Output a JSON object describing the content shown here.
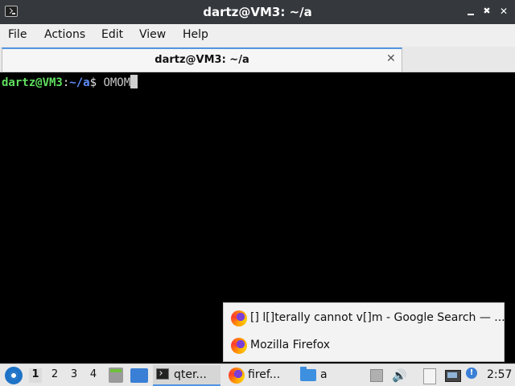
{
  "window": {
    "title": "dartz@VM3: ~/a",
    "controls": {
      "minimize_icon": "minimize-icon",
      "maximize_label": "✖",
      "close_label": "✕"
    }
  },
  "menu": [
    "File",
    "Actions",
    "Edit",
    "View",
    "Help"
  ],
  "tab": {
    "label": "dartz@VM3: ~/a",
    "close_label": "✕"
  },
  "terminal": {
    "user_host": "dartz@VM3",
    "colon": ":",
    "path": "~/a",
    "dollar": "$ ",
    "command": "OMOM"
  },
  "popup": {
    "items": [
      {
        "label": "[] l[]terally cannot v[]m - Google Search — ...",
        "icon": "firefox-icon"
      },
      {
        "label": "Mozilla Firefox",
        "icon": "firefox-icon"
      }
    ]
  },
  "taskbar": {
    "desktops": [
      "1",
      "2",
      "3",
      "4"
    ],
    "active_desktop": "1",
    "tasks": {
      "terminal": "qter...",
      "firefox": "firef...",
      "folder": "a"
    },
    "volume_glyph": "🔊",
    "clock": "2:57"
  },
  "colors": {
    "titlebar": "#35383d",
    "accent": "#5294e2",
    "prompt_user": "#5fdf5f",
    "prompt_path": "#5f8fff",
    "terminal_bg": "#000000"
  }
}
